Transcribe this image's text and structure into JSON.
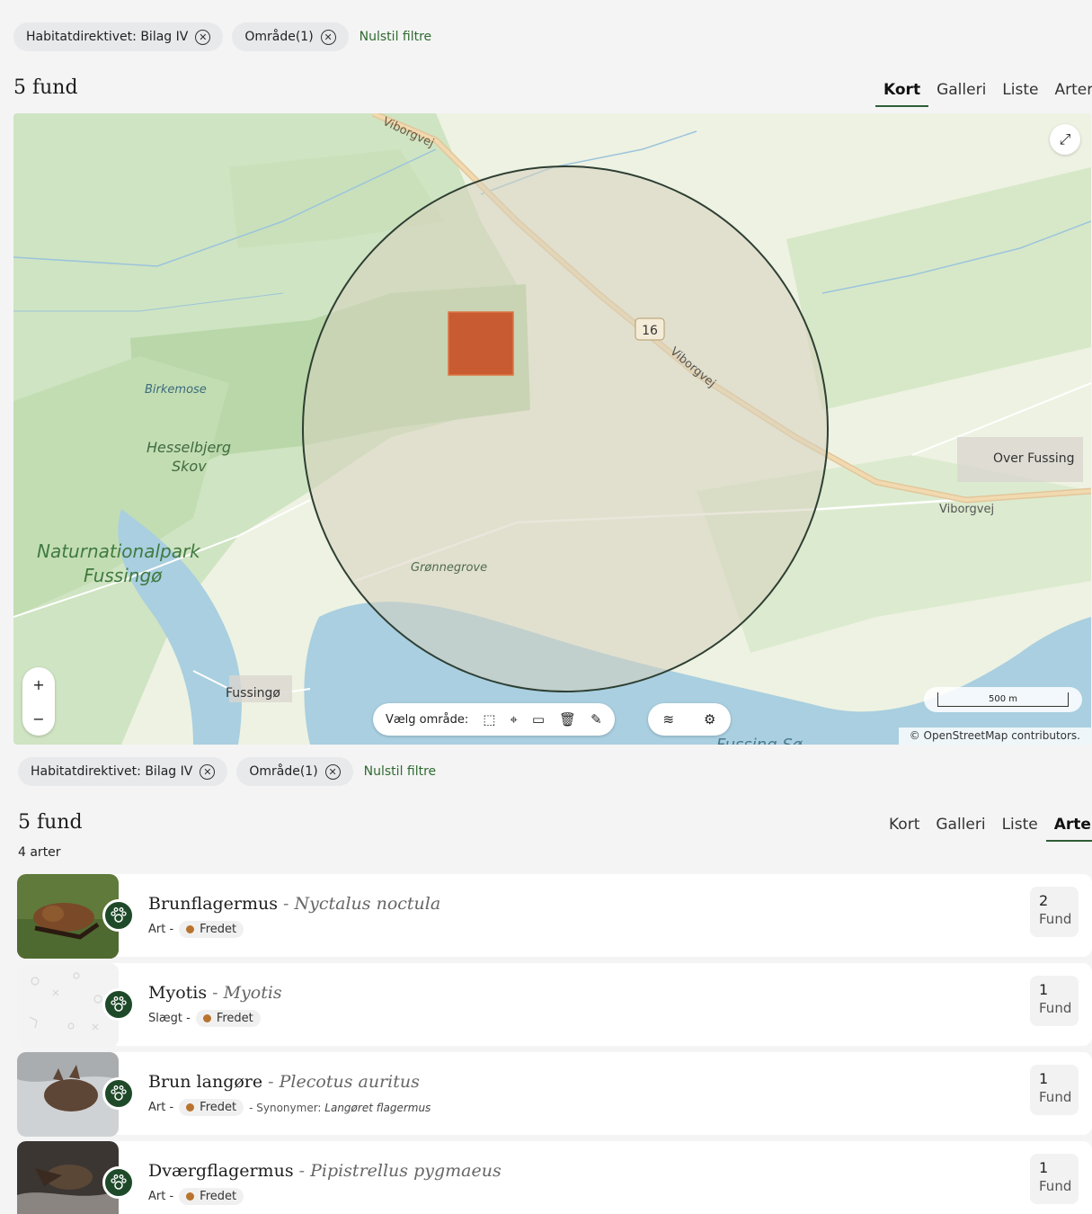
{
  "top": {
    "filters": [
      {
        "label": "Habitatdirektivet: Bilag IV"
      },
      {
        "label": "Område(1)"
      }
    ],
    "reset_label": "Nulstil filtre",
    "count_title": "5 fund",
    "tabs": [
      {
        "label": "Kort",
        "active": true
      },
      {
        "label": "Galleri",
        "active": false
      },
      {
        "label": "Liste",
        "active": false
      },
      {
        "label": "Arter",
        "active": false
      }
    ]
  },
  "map": {
    "fullscreen_icon": "⤢",
    "zoom_in": "+",
    "zoom_out": "−",
    "area_label": "Vælg område:",
    "scale_label": "500 m",
    "attribution": "© OpenStreetMap contributors.",
    "place_labels": {
      "viborgvej_top": "Viborgvej",
      "route_number": "16",
      "viborgvej_mid": "Viborgvej",
      "viborgvej_right": "Viborgvej",
      "birkemose": "Birkemose",
      "hesselbjerg_1": "Hesselbjerg",
      "hesselbjerg_2": "Skov",
      "naturnationalpark_1": "Naturnationalpark",
      "naturnationalpark_2": "Fussingø",
      "gronnegrove": "Grønnegrove",
      "over_fussing": "Over Fussing",
      "fussingo_town": "Fussingø",
      "fussing_so": "Fussing Sø"
    }
  },
  "bottom": {
    "filters": [
      {
        "label": "Habitatdirektivet: Bilag IV"
      },
      {
        "label": "Område(1)"
      }
    ],
    "reset_label": "Nulstil filtre",
    "count_title": "5 fund",
    "species_count": "4 arter",
    "tabs": [
      {
        "label": "Kort",
        "active": false
      },
      {
        "label": "Galleri",
        "active": false
      },
      {
        "label": "Liste",
        "active": false
      },
      {
        "label": "Arter",
        "active": true
      }
    ]
  },
  "species": [
    {
      "name": "Brunflagermus",
      "sep": " - ",
      "latin": "Nyctalus noctula",
      "rank": "Art -",
      "status": "Fredet",
      "synonyms": "",
      "synonym_name": "",
      "count": "2",
      "count_label": "Fund"
    },
    {
      "name": "Myotis",
      "sep": " - ",
      "latin": "Myotis",
      "rank": "Slægt -",
      "status": "Fredet",
      "synonyms": "",
      "synonym_name": "",
      "count": "1",
      "count_label": "Fund"
    },
    {
      "name": "Brun langøre",
      "sep": " - ",
      "latin": "Plecotus auritus",
      "rank": "Art -",
      "status": "Fredet",
      "synonyms": "- Synonymer: ",
      "synonym_name": "Langøret flagermus",
      "count": "1",
      "count_label": "Fund"
    },
    {
      "name": "Dværgflagermus",
      "sep": " - ",
      "latin": "Pipistrellus pygmaeus",
      "rank": "Art -",
      "status": "Fredet",
      "synonyms": "",
      "synonym_name": "",
      "count": "1",
      "count_label": "Fund"
    }
  ],
  "colors": {
    "accent_green": "#2f6b2f",
    "badge_green": "#1f4a2a",
    "status_dot": "#b8742e",
    "selection_square": "#c8552b"
  }
}
